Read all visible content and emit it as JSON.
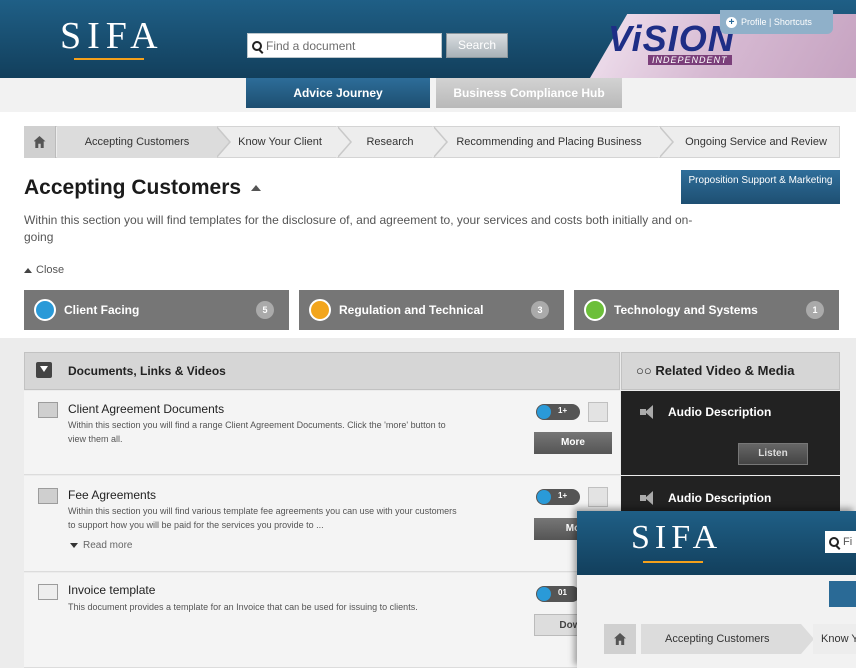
{
  "header": {
    "logo": "SIFA",
    "search_placeholder": "Find a document",
    "search_button": "Search",
    "brand": "ViSION",
    "brand_sub": "INDEPENDENT",
    "profile_link": "Profile | Shortcuts"
  },
  "nav": {
    "tabs": [
      {
        "label": "Advice Journey",
        "active": true
      },
      {
        "label": "Business Compliance Hub",
        "active": false
      }
    ]
  },
  "breadcrumb": {
    "items": [
      {
        "label": "Accepting Customers",
        "active": true
      },
      {
        "label": "Know Your Client"
      },
      {
        "label": "Research"
      },
      {
        "label": "Recommending and Placing Business"
      },
      {
        "label": "Ongoing Service and Review"
      }
    ]
  },
  "section": {
    "title": "Accepting Customers",
    "proposition_button": "Proposition Support & Marketing",
    "intro": "Within this section you will find templates for the disclosure of, and agreement to, your services and costs both initially and on-going",
    "close_label": "Close"
  },
  "categories": [
    {
      "label": "Client Facing",
      "count": "5",
      "color": "#2a9ad8"
    },
    {
      "label": "Regulation and Technical",
      "count": "3",
      "color": "#f2a51d"
    },
    {
      "label": "Technology and Systems",
      "count": "1",
      "color": "#6cbf3a"
    }
  ],
  "documents": {
    "header": "Documents, Links & Videos",
    "items": [
      {
        "name": "Client Agreement Documents",
        "desc": "Within this section you will find a range Client Agreement Documents. Click the 'more' button to view them all.",
        "toggle": "1+",
        "action": "More",
        "read_more": ""
      },
      {
        "name": "Fee Agreements",
        "desc": "Within this section you will find various template fee agreements you can use with your customers to support how you will be paid for the services you provide to ...",
        "toggle": "1+",
        "action": "Mo",
        "read_more": "Read more"
      },
      {
        "name": "Invoice template",
        "desc": "This document provides a template for an Invoice that can be used for issuing to clients.",
        "toggle": "01",
        "action": "Down",
        "read_more": ""
      }
    ]
  },
  "media": {
    "header": "Related Video & Media",
    "items": [
      {
        "label": "Audio Description",
        "action": "Listen"
      },
      {
        "label": "Audio Description",
        "action": ""
      }
    ]
  },
  "overlay": {
    "logo": "SIFA",
    "search_fragment": "Fi",
    "crumb_active": "Accepting Customers",
    "crumb_next": "Know Y"
  }
}
